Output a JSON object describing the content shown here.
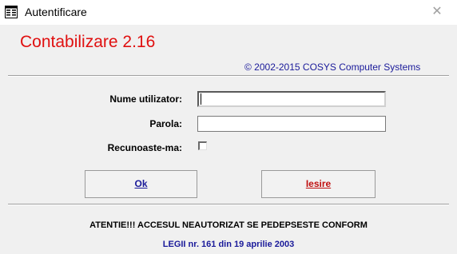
{
  "window": {
    "title": "Autentificare",
    "close_glyph": "✕",
    "app_icon": "form-icon"
  },
  "header": {
    "app_title": "Contabilizare 2.16",
    "copyright": "© 2002-2015 COSYS Computer Systems"
  },
  "form": {
    "username_label": "Nume utilizator:",
    "username_value": "",
    "password_label": "Parola:",
    "password_value": "",
    "remember_label": "Recunoaste-ma:",
    "remember_checked": false
  },
  "buttons": {
    "ok_label": "Ok",
    "exit_label": "Iesire"
  },
  "footer": {
    "warning": "ATENTIE!!! ACCESUL NEAUTORIZAT SE PEDEPSESTE CONFORM",
    "law": "LEGII nr. 161 din 19 aprilie 2003"
  },
  "colors": {
    "title_red": "#e01010",
    "link_blue": "#1a1a9a",
    "exit_red": "#c01010"
  }
}
